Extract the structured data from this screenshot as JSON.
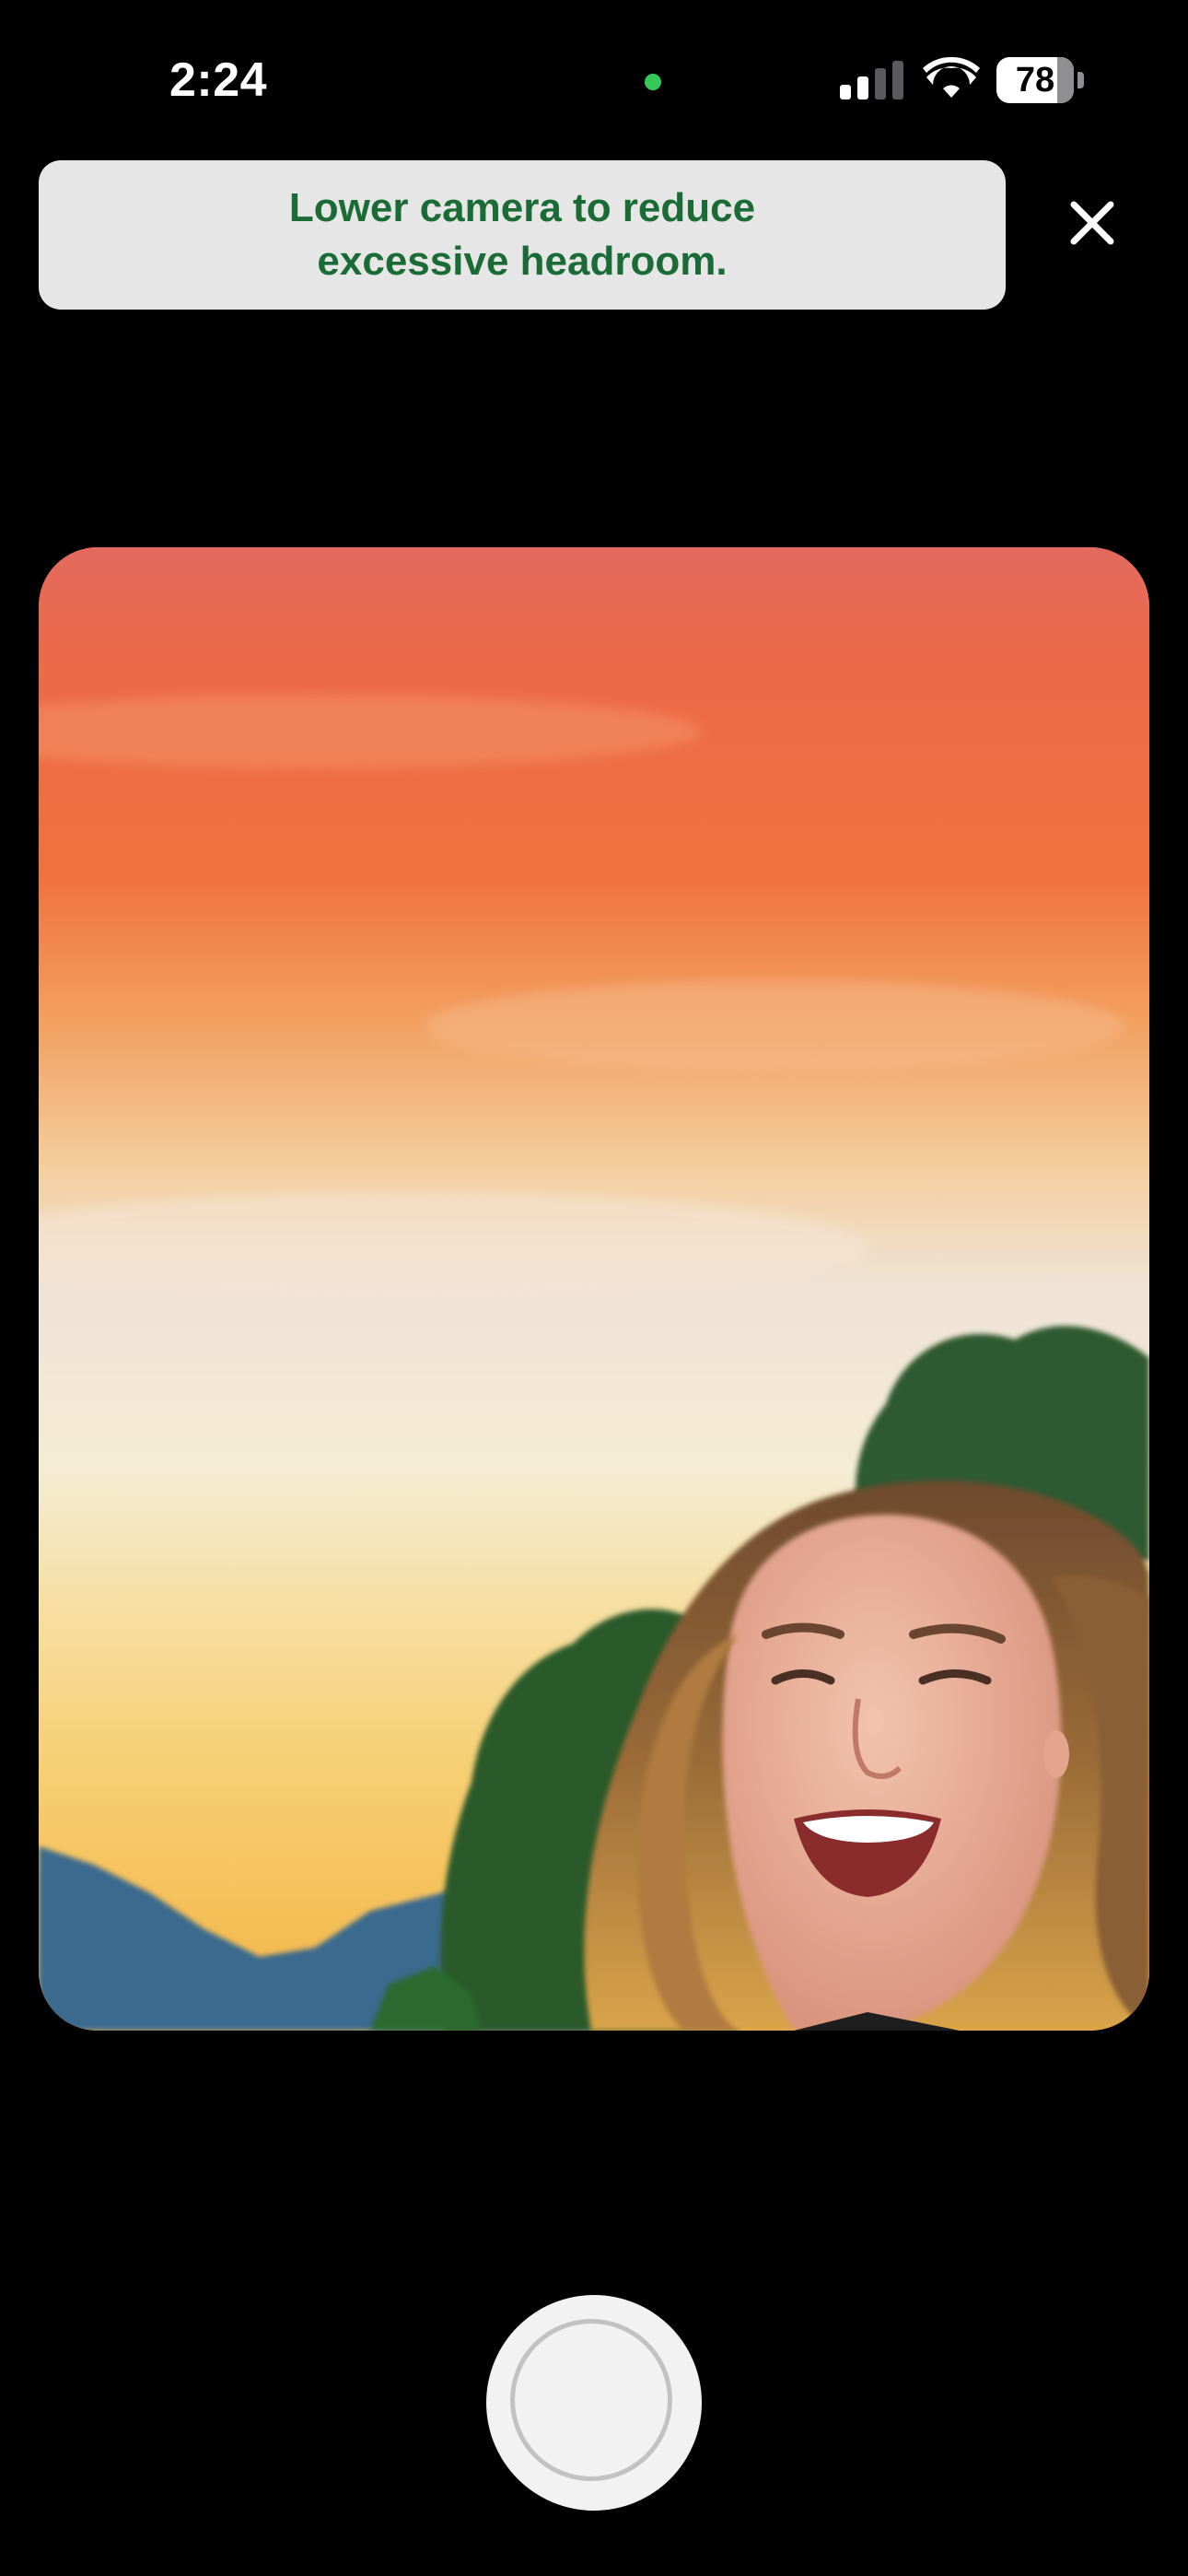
{
  "status_bar": {
    "time": "2:24",
    "battery": "78",
    "battery_level": 0.78,
    "camera_indicator_color": "#34c759",
    "icons": [
      "signal-icon",
      "wifi-icon",
      "battery-icon"
    ]
  },
  "banner": {
    "message": "Lower camera to reduce excessive headroom.",
    "text_color": "#1a6b35",
    "background": "#e6e6e6"
  },
  "close_button": {
    "icon": "close-icon"
  },
  "preview": {
    "content": "camera-preview"
  },
  "shutter": {
    "icon": "shutter-button"
  }
}
